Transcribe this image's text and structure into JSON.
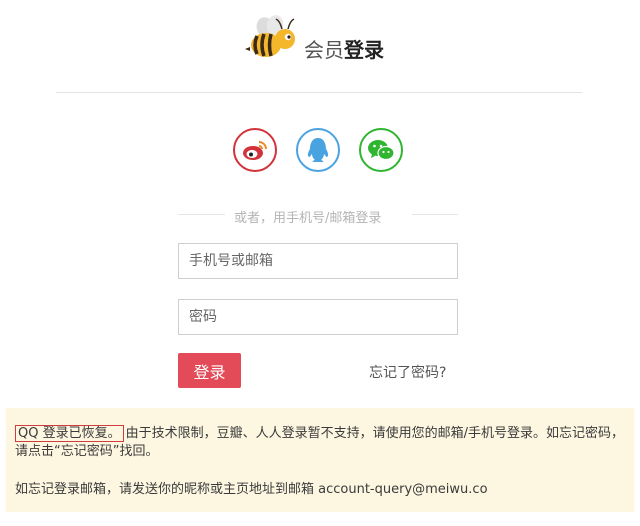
{
  "header": {
    "title_prefix": "会员",
    "title_main": "登录",
    "logo_icon": "bee-logo-icon"
  },
  "social": {
    "weibo_icon": "weibo-icon",
    "qq_icon": "qq-icon",
    "wechat_icon": "wechat-icon",
    "colors": {
      "weibo": "#d2333a",
      "qq": "#4aa3e1",
      "wechat": "#2fb52f"
    }
  },
  "divider_text": "或者，用手机号/邮箱登录",
  "form": {
    "phone_placeholder": "手机号或邮箱",
    "password_placeholder": "密码",
    "login_label": "登录",
    "forgot_label": "忘记了密码?"
  },
  "notice": {
    "restored": "QQ 登录已恢复。",
    "line1_rest": "由于技术限制，豆瓣、人人登录暂不支持，请使用您的邮箱/手机号登录。如忘记密码，请点击“忘记密码”找回。",
    "line2": "如忘记登录邮箱，请发送你的昵称或主页地址到邮箱 account-query@meiwu.co"
  },
  "colors": {
    "accent": "#e24b57",
    "notice_bg": "#fdf7e1"
  }
}
